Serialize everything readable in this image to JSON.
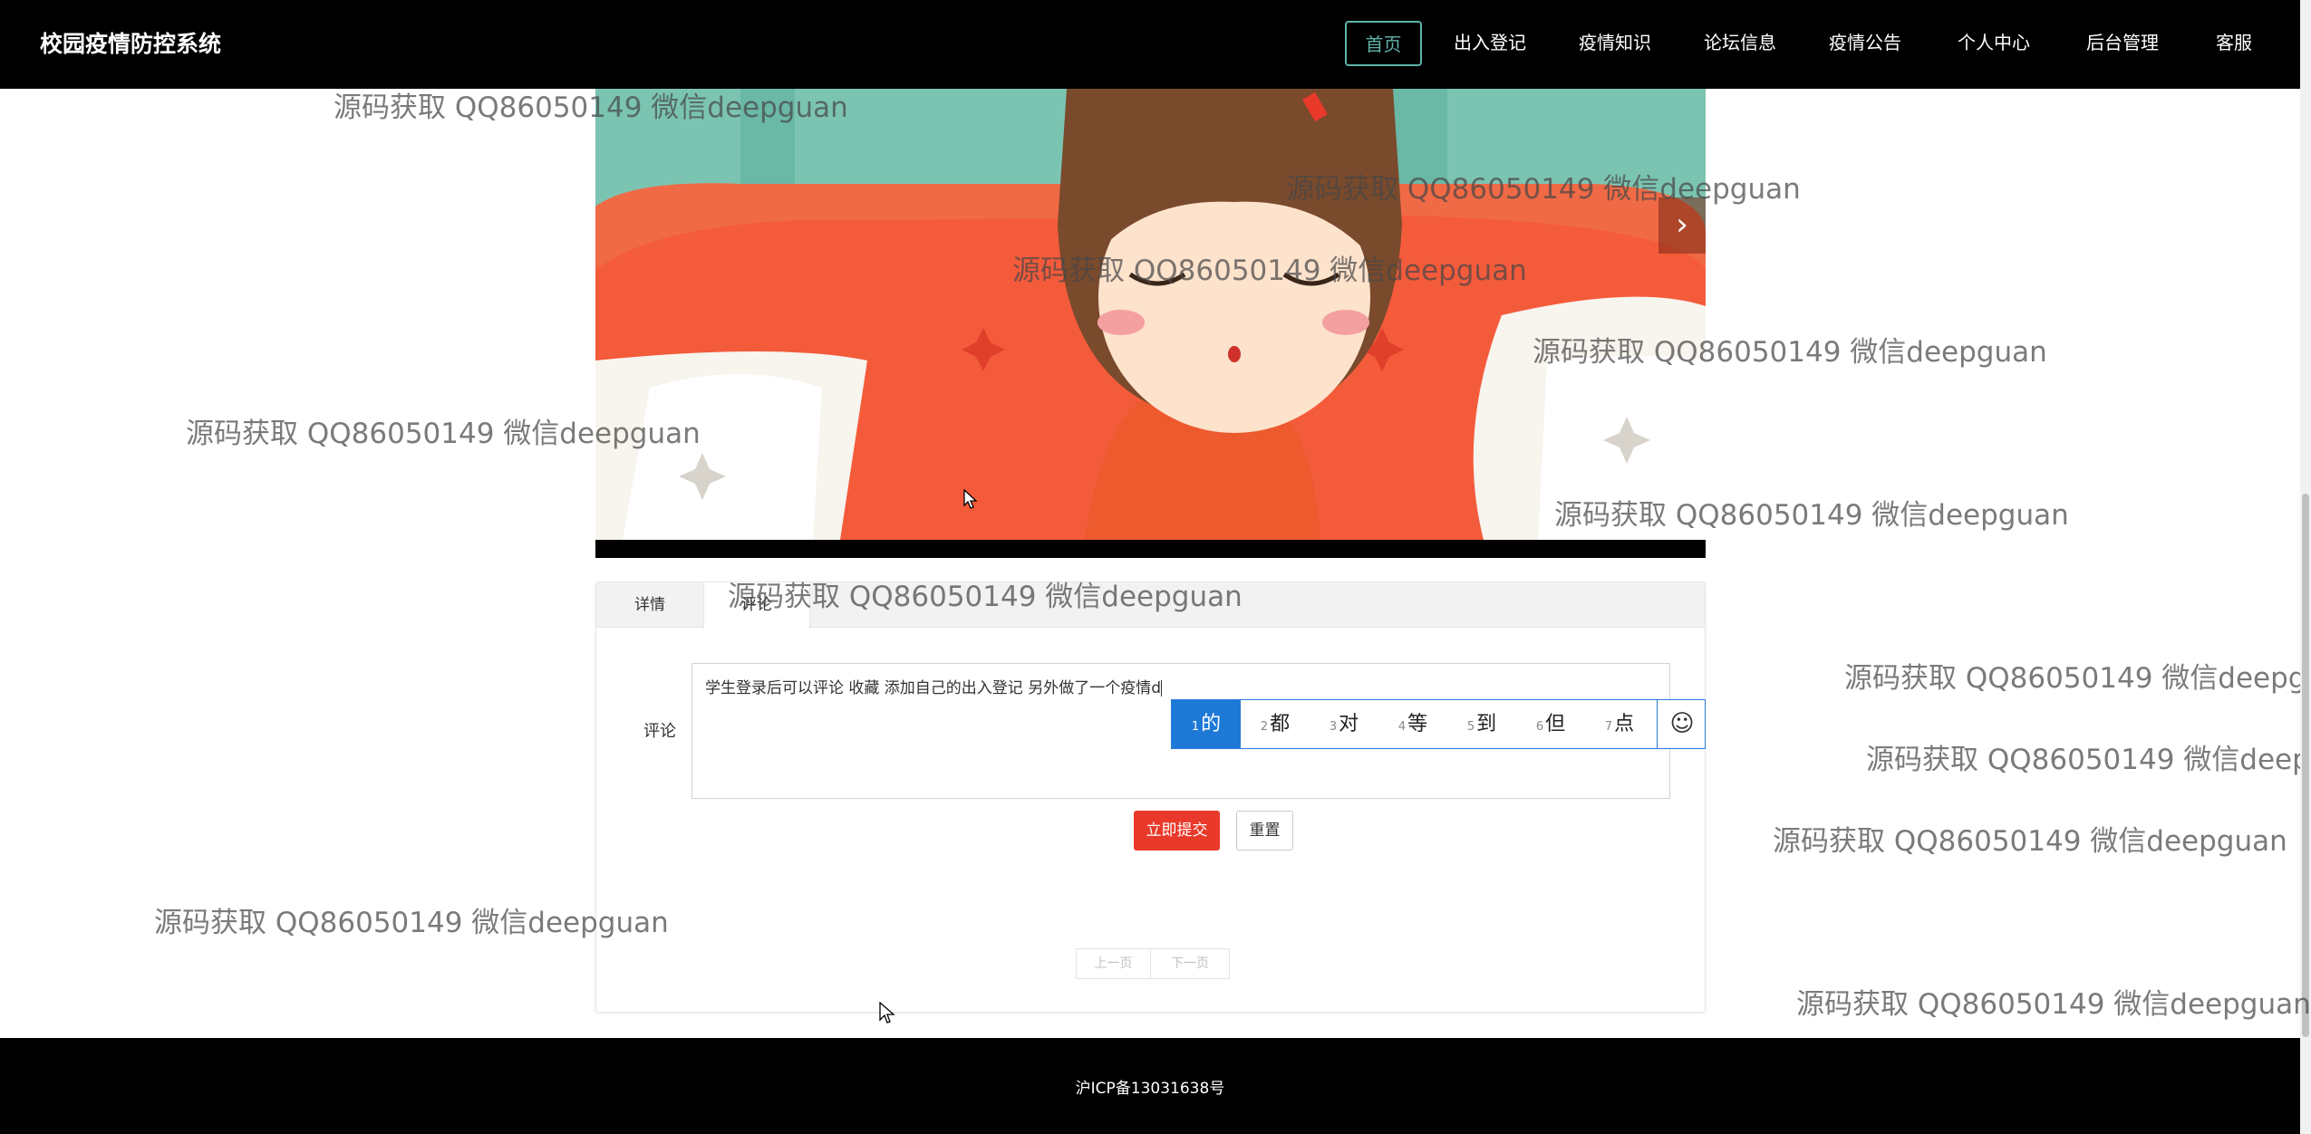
{
  "header": {
    "brand": "校园疫情防控系统",
    "nav": [
      {
        "label": "首页",
        "active": true
      },
      {
        "label": "出入登记",
        "active": false
      },
      {
        "label": "疫情知识",
        "active": false
      },
      {
        "label": "论坛信息",
        "active": false
      },
      {
        "label": "疫情公告",
        "active": false
      },
      {
        "label": "个人中心",
        "active": false
      },
      {
        "label": "后台管理",
        "active": false
      },
      {
        "label": "客服",
        "active": false
      }
    ]
  },
  "video": {
    "next_icon": "chevron-right-icon"
  },
  "tabs": [
    {
      "label": "详情",
      "active": false
    },
    {
      "label": "评论",
      "active": true
    }
  ],
  "comment_form": {
    "label": "评论",
    "value": "学生登录后可以评论  收藏  添加自己的出入登记  另外做了一个疫情d",
    "submit_label": "立即提交",
    "reset_label": "重置"
  },
  "ime": {
    "candidates": [
      {
        "n": "1",
        "text": "的"
      },
      {
        "n": "2",
        "text": "都"
      },
      {
        "n": "3",
        "text": "对"
      },
      {
        "n": "4",
        "text": "等"
      },
      {
        "n": "5",
        "text": "到"
      },
      {
        "n": "6",
        "text": "但"
      },
      {
        "n": "7",
        "text": "点"
      }
    ],
    "emoji_icon": "smiley-icon"
  },
  "pagination": {
    "prev_label": "上一页",
    "next_label": "下一页"
  },
  "footer": {
    "icp": "沪ICP备13031638号"
  },
  "watermark_text": "源码获取 QQ86050149 微信deepguan",
  "colors": {
    "nav_active": "#5fb3a9",
    "submit": "#e8392a",
    "ime_selected": "#1e78d6"
  }
}
